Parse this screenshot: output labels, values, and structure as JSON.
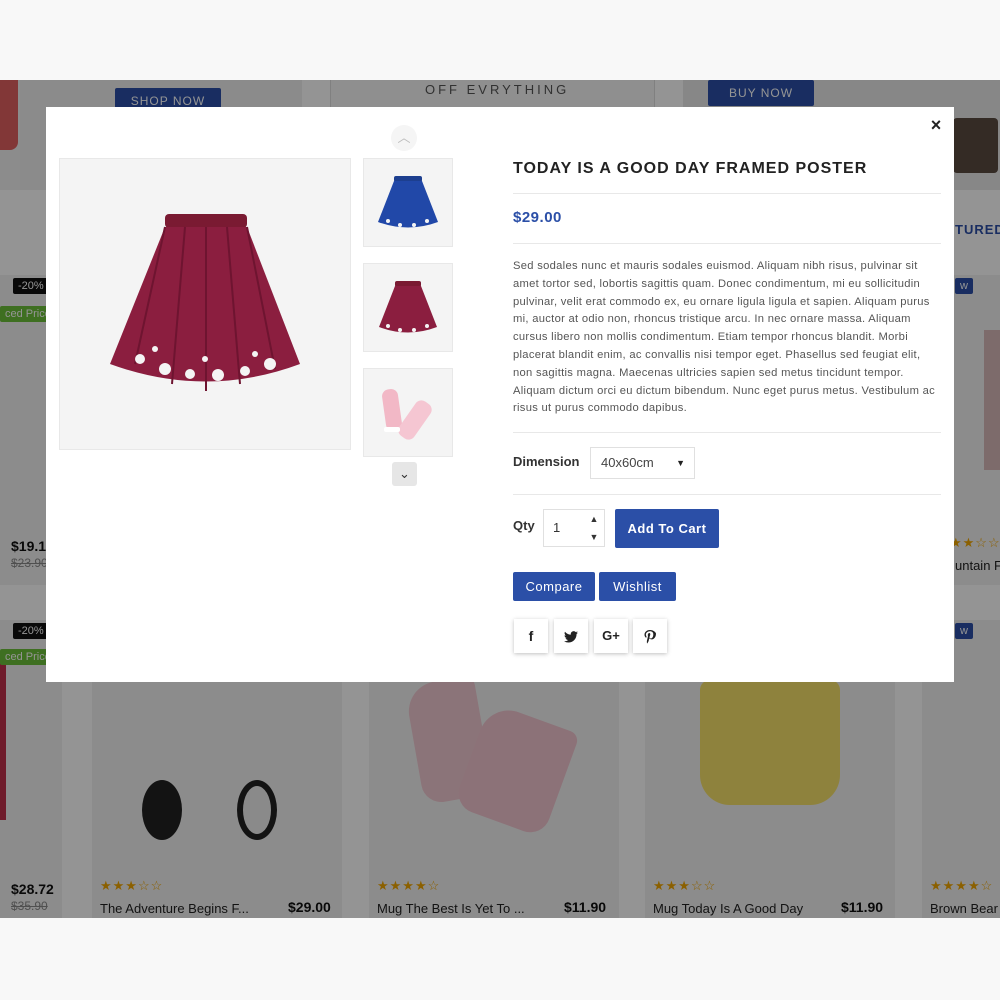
{
  "background": {
    "banners": [
      {
        "button": "SHOP NOW"
      },
      {
        "text": "OFF EVRYTHING"
      },
      {
        "button": "BUY NOW"
      }
    ],
    "side_labels": {
      "featured": "TURED"
    },
    "row1": {
      "left_badge": "-20%",
      "left_price_tag": "ced Price",
      "left_price": "$19.1",
      "left_old_price": "$23.90",
      "right_badge": "w",
      "right_name": "untain F"
    },
    "row2": {
      "left_badge": "-20%",
      "left_price_tag": "ced Price",
      "left_price": "$28.72",
      "left_old_price": "$35.90",
      "right_badge": "w",
      "products": [
        {
          "name": "The Adventure Begins F...",
          "price": "$29.00",
          "stars": "★★★☆☆"
        },
        {
          "name": "Mug The Best Is Yet To ...",
          "price": "$11.90",
          "stars": "★★★★☆"
        },
        {
          "name": "Mug Today Is A Good Day",
          "price": "$11.90",
          "stars": "★★★☆☆"
        },
        {
          "name": "Brown Bear",
          "price": "",
          "stars": "★★★★☆"
        }
      ]
    }
  },
  "modal": {
    "close_icon": "×",
    "title": "TODAY IS A GOOD DAY FRAMED POSTER",
    "price": "$29.00",
    "description": "Sed sodales nunc et mauris sodales euismod. Aliquam nibh risus, pulvinar sit amet tortor sed, lobortis sagittis quam. Donec condimentum, mi eu sollicitudin pulvinar, velit erat commodo ex, eu ornare ligula ligula et sapien. Aliquam purus mi, auctor at odio non, rhoncus tristique arcu. In nec ornare massa. Aliquam cursus libero non mollis condimentum. Etiam tempor rhoncus blandit. Morbi placerat blandit enim, ac convallis nisi tempor eget. Phasellus sed feugiat elit, non sagittis magna. Maecenas ultricies sapien sed metus tincidunt tempor. Aliquam dictum orci eu dictum bibendum. Nunc eget purus metus. Vestibulum ac risus ut purus commodo dapibus.",
    "dimension_label": "Dimension",
    "dimension_value": "40x60cm",
    "qty_label": "Qty",
    "qty_value": "1",
    "add_to_cart": "Add To Cart",
    "compare": "Compare",
    "wishlist": "Wishlist",
    "social": [
      {
        "icon": "facebook-icon",
        "glyph": "f"
      },
      {
        "icon": "twitter-icon",
        "glyph": "🐦"
      },
      {
        "icon": "google-plus-icon",
        "glyph": "G+"
      },
      {
        "icon": "pinterest-icon",
        "glyph": "P"
      }
    ],
    "thumbnails": [
      "blue-skirt",
      "red-skirt",
      "pink-sneakers"
    ]
  },
  "colors": {
    "accent": "#2b4fa7",
    "badge_dark": "#111111",
    "badge_green": "#6cbf3a",
    "star": "#f0a500"
  }
}
